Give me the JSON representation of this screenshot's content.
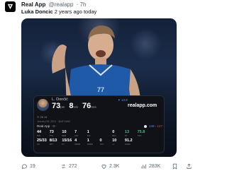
{
  "post": {
    "author_name": "Real App",
    "handle": "@realapp",
    "time": "· 7h",
    "text_name": "Luka Doncic",
    "text_rest": "2 years ago today"
  },
  "card": {
    "player_name": "L. Dončić",
    "pts_value": "73",
    "pts_label": "pts",
    "reb_value": "8",
    "reb_label": "reb",
    "ts_value": "76",
    "ts_label": "%ts",
    "badge": "✦ 13.8",
    "brand": "realapp.com",
    "meta": "⊙ 26.14",
    "date": "January 26, 2024 · @ATLMAV",
    "game_label": "Real App",
    "game_sub": "· G ·",
    "game_score_a": "148",
    "game_score_b": "147",
    "stats_row1": [
      {
        "v": "44",
        "k": "MIN"
      },
      {
        "v": "73",
        "k": "PTS"
      },
      {
        "v": "10",
        "k": "REB"
      },
      {
        "v": "7",
        "k": "AST"
      },
      {
        "v": "1",
        "k": "STL"
      },
      {
        "v": "",
        "k": ""
      },
      {
        "v": "0",
        "k": "BLK"
      },
      {
        "v": "13",
        "k": "PF"
      },
      {
        "v": "75.8",
        "k": "TS%"
      },
      {
        "v": "",
        "k": ""
      }
    ],
    "stats_row2": [
      {
        "v": "25/33",
        "k": "FG"
      },
      {
        "v": "8/13",
        "k": "3PT"
      },
      {
        "v": "15/16",
        "k": "FT"
      },
      {
        "v": "4",
        "k": "OREB"
      },
      {
        "v": "1",
        "k": "DREB"
      },
      {
        "v": "0",
        "k": "TOV"
      },
      {
        "v": "10",
        "k": "+/-"
      },
      {
        "v": "91.2",
        "k": "GMSC"
      },
      {
        "v": "",
        "k": ""
      },
      {
        "v": "",
        "k": ""
      }
    ]
  },
  "actions": {
    "replies": "19",
    "reposts": "272",
    "likes": "2.3K",
    "views": "283K"
  },
  "colors": {
    "accent": "#1d9bf0",
    "text_secondary": "#536471",
    "green": "#3ec47a"
  }
}
